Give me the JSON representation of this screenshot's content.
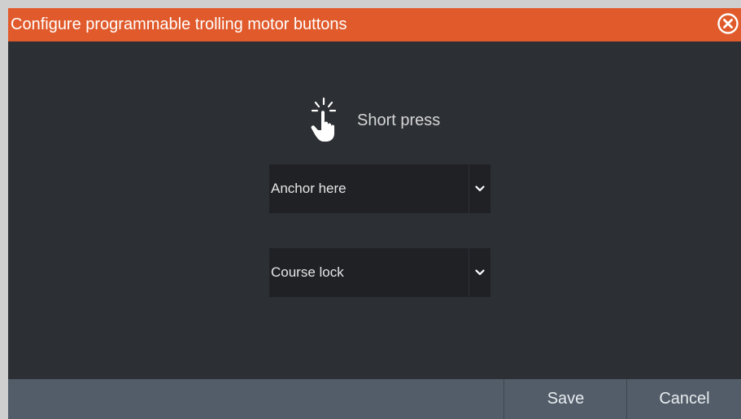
{
  "dialog": {
    "title": "Configure programmable trolling motor buttons",
    "close_icon": "close-circle-icon",
    "accent_color": "#e05a2b"
  },
  "prompt": {
    "icon": "hand-press-icon",
    "label": "Short press"
  },
  "dropdowns": [
    {
      "value": "Anchor here",
      "icon": "chevron-down-icon"
    },
    {
      "value": "Course lock",
      "icon": "chevron-down-icon"
    }
  ],
  "footer": {
    "save_label": "Save",
    "cancel_label": "Cancel"
  }
}
